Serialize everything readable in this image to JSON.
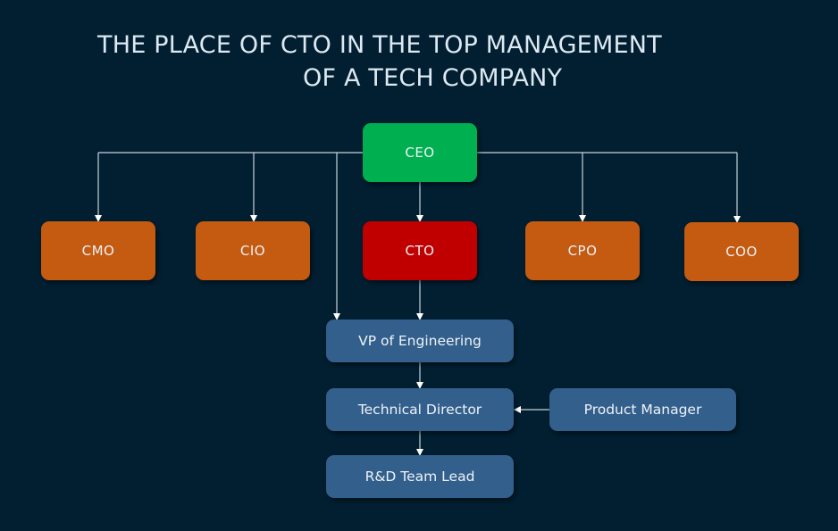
{
  "title": {
    "line1": "THE PLACE OF CTO IN THE TOP MANAGEMENT",
    "line2": "OF A TECH COMPANY"
  },
  "colors": {
    "background": "#011f30",
    "ceo": "#00b050",
    "cto": "#c00000",
    "executive": "#c55a11",
    "team": "#335f8c",
    "connector": "#c8d3dc"
  },
  "nodes": {
    "ceo": {
      "label": "CEO",
      "role": "root"
    },
    "cmo": {
      "label": "CMO",
      "role": "executive"
    },
    "cio": {
      "label": "CIO",
      "role": "executive"
    },
    "cto": {
      "label": "CTO",
      "role": "highlight"
    },
    "cpo": {
      "label": "CPO",
      "role": "executive"
    },
    "coo": {
      "label": "COO",
      "role": "executive"
    },
    "vpe": {
      "label": "VP of Engineering",
      "role": "team"
    },
    "td": {
      "label": "Technical Director",
      "role": "team"
    },
    "pm": {
      "label": "Product Manager",
      "role": "team"
    },
    "rd": {
      "label": "R&D Team Lead",
      "role": "team"
    }
  },
  "edges": [
    {
      "from": "ceo",
      "to": "cmo"
    },
    {
      "from": "ceo",
      "to": "cio"
    },
    {
      "from": "ceo",
      "to": "cto"
    },
    {
      "from": "ceo",
      "to": "cpo"
    },
    {
      "from": "ceo",
      "to": "coo"
    },
    {
      "from": "ceo",
      "to": "vpe"
    },
    {
      "from": "cto",
      "to": "vpe"
    },
    {
      "from": "vpe",
      "to": "td"
    },
    {
      "from": "pm",
      "to": "td"
    },
    {
      "from": "td",
      "to": "rd"
    }
  ]
}
